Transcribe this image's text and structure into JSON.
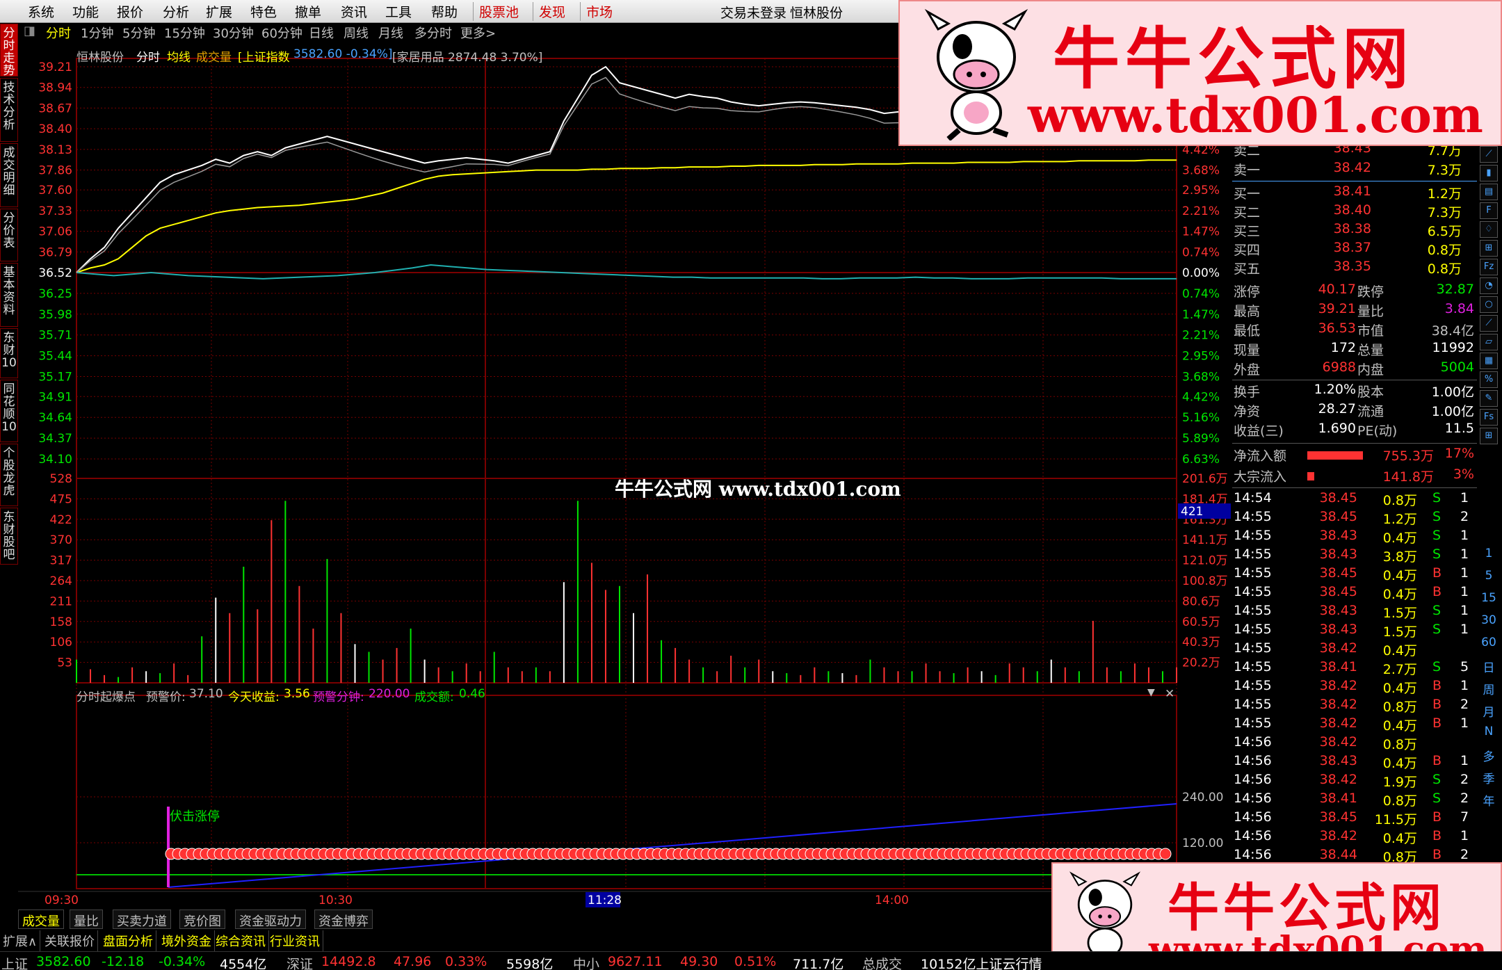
{
  "menubar": {
    "items": [
      "系统",
      "功能",
      "报价",
      "分析",
      "扩展",
      "特色",
      "撤单",
      "资讯",
      "工具",
      "帮助"
    ],
    "highlight": [
      "股票池",
      "发现",
      "市场"
    ],
    "login": "交易未登录",
    "stock_title": "恒林股份"
  },
  "sidetabs": [
    "分时走势",
    "技术分析",
    "成交明细",
    "分价表",
    "基本资料",
    "东财10",
    "同花顺10",
    "个股龙虎",
    "东财股吧"
  ],
  "periods": [
    "分时",
    "1分钟",
    "5分钟",
    "15分钟",
    "30分钟",
    "60分钟",
    "日线",
    "周线",
    "月线",
    "多分时",
    "更多>"
  ],
  "info_line": {
    "name": "恒林股份",
    "mode": "分时",
    "avg": "均线",
    "vol": "成交量",
    "index": "[上证指数",
    "index_val": "3582.60 -0.34%]",
    "sector": "[家居用品 2874.48 3.70%]"
  },
  "price_axis": {
    "left_up": [
      "39.21",
      "38.94",
      "38.67",
      "38.40",
      "38.13",
      "37.86",
      "37.60",
      "37.33",
      "37.06",
      "36.79"
    ],
    "mid": "36.52",
    "left_down": [
      "36.25",
      "35.98",
      "35.71",
      "35.44",
      "35.17",
      "34.91",
      "34.64",
      "34.37",
      "34.10"
    ],
    "right_up": [
      "4.42%",
      "3.68%",
      "2.95%",
      "2.21%",
      "1.47%",
      "0.74%"
    ],
    "right_mid": "0.00%",
    "right_down": [
      "0.74%",
      "1.47%",
      "2.21%",
      "2.95%",
      "3.68%",
      "4.42%",
      "5.16%",
      "5.89%",
      "6.63%"
    ]
  },
  "vol_axis": {
    "left": [
      "528",
      "475",
      "422",
      "370",
      "317",
      "264",
      "211",
      "158",
      "106",
      "53"
    ],
    "right": [
      "201.6万",
      "181.4万",
      "161.3万",
      "141.1万",
      "121.0万",
      "100.8万",
      "80.6万",
      "60.5万",
      "40.3万",
      "20.2万"
    ],
    "cursor": "421"
  },
  "indicator": {
    "name": "分时起爆点",
    "warn_label": "预警价:",
    "warn_val": "37.10",
    "income_label": "今天收益:",
    "income_val": "3.56",
    "warnmin_label": "预警分钟:",
    "warnmin_val": "220.00",
    "amount_label": "成交额:",
    "amount_val": "0.46",
    "signal": "伏击涨停",
    "axis": [
      "240.00",
      "120.00"
    ]
  },
  "time_axis": {
    "labels": [
      "09:30",
      "10:30",
      "11:28",
      "14:00"
    ],
    "cursor": "11:28"
  },
  "orderbook": {
    "sells": [
      {
        "label": "卖二",
        "price": "38.43",
        "vol": "7.7万"
      },
      {
        "label": "卖一",
        "price": "38.42",
        "vol": "7.3万"
      }
    ],
    "buys": [
      {
        "label": "买一",
        "price": "38.41",
        "vol": "1.2万"
      },
      {
        "label": "买二",
        "price": "38.40",
        "vol": "7.3万"
      },
      {
        "label": "买三",
        "price": "38.38",
        "vol": "6.5万"
      },
      {
        "label": "买四",
        "price": "38.37",
        "vol": "0.8万"
      },
      {
        "label": "买五",
        "price": "38.35",
        "vol": "0.8万"
      }
    ]
  },
  "stats": [
    [
      "涨停",
      "40.17",
      "跌停",
      "32.87"
    ],
    [
      "最高",
      "39.21",
      "量比",
      "3.84"
    ],
    [
      "最低",
      "36.53",
      "市值",
      "38.4亿"
    ],
    [
      "现量",
      "172",
      "总量",
      "11992"
    ],
    [
      "外盘",
      "6988",
      "内盘",
      "5004"
    ],
    [
      "换手",
      "1.20%",
      "股本",
      "1.00亿"
    ],
    [
      "净资",
      "28.27",
      "流通",
      "1.00亿"
    ],
    [
      "收益(三)",
      "1.690",
      "PE(动)",
      "11.5"
    ]
  ],
  "flows": [
    {
      "label": "净流入额",
      "val": "755.3万",
      "pct": "17%",
      "fill": 1
    },
    {
      "label": "大宗流入",
      "val": "141.8万",
      "pct": "3%",
      "fill": 0.12
    }
  ],
  "ticks": [
    [
      "14:54",
      "38.45",
      "0.8万",
      "S",
      "1"
    ],
    [
      "14:55",
      "38.45",
      "1.2万",
      "S",
      "2"
    ],
    [
      "14:55",
      "38.43",
      "0.4万",
      "S",
      "1"
    ],
    [
      "14:55",
      "38.43",
      "3.8万",
      "S",
      "1"
    ],
    [
      "14:55",
      "38.45",
      "0.4万",
      "B",
      "1"
    ],
    [
      "14:55",
      "38.45",
      "0.4万",
      "B",
      "1"
    ],
    [
      "14:55",
      "38.43",
      "1.5万",
      "S",
      "1"
    ],
    [
      "14:55",
      "38.43",
      "1.5万",
      "S",
      "1"
    ],
    [
      "14:55",
      "38.42",
      "0.4万",
      "",
      ""
    ],
    [
      "14:55",
      "38.41",
      "2.7万",
      "S",
      "5"
    ],
    [
      "14:55",
      "38.42",
      "0.4万",
      "B",
      "1"
    ],
    [
      "14:55",
      "38.42",
      "0.8万",
      "B",
      "2"
    ],
    [
      "14:55",
      "38.42",
      "0.4万",
      "B",
      "1"
    ],
    [
      "14:56",
      "38.42",
      "0.8万",
      "",
      ""
    ],
    [
      "14:56",
      "38.43",
      "0.4万",
      "B",
      "1"
    ],
    [
      "14:56",
      "38.42",
      "1.9万",
      "S",
      "2"
    ],
    [
      "14:56",
      "38.41",
      "0.8万",
      "S",
      "2"
    ],
    [
      "14:56",
      "38.45",
      "11.5万",
      "B",
      "7"
    ],
    [
      "14:56",
      "38.42",
      "0.4万",
      "B",
      "1"
    ],
    [
      "14:56",
      "38.44",
      "0.8万",
      "B",
      "2"
    ]
  ],
  "right_icons": [
    "1",
    "5",
    "15",
    "30",
    "60",
    "日",
    "周",
    "月",
    "N",
    "多",
    "季",
    "年"
  ],
  "subtabs": [
    "成交量",
    "量比",
    "买卖力道",
    "竞价图",
    "资金驱动力",
    "资金博弈"
  ],
  "bottomtabs": [
    "扩展∧",
    "关联报价",
    "盘面分析",
    "境外资金",
    "综合资讯",
    "行业资讯"
  ],
  "statusbar": {
    "sh": "上证",
    "sh_val": "3582.60",
    "sh_chg": "-12.18",
    "sh_pct": "-0.34%",
    "sh_amt": "4554亿",
    "sz": "深证",
    "sz_val": "14492.8",
    "sz_chg": "47.96",
    "sz_pct": "0.33%",
    "sz_amt": "5598亿",
    "zx": "中小",
    "zx_val": "9627.11",
    "zx_chg": "49.30",
    "zx_pct": "0.51%",
    "zx_amt": "711.7亿",
    "total": "总成交",
    "total_val": "10152亿上证云行情"
  },
  "watermark": {
    "title": "牛牛公式网",
    "url": "www.tdx001.com",
    "center": "牛牛公式网 www.tdx001.com"
  },
  "colors": {
    "up": "#ff3232",
    "down": "#00e600",
    "grid": "#7a0000",
    "price": "#ffffff",
    "avg": "#ffff00",
    "index": "#20b0b0"
  },
  "series": {
    "price": [
      36.52,
      36.7,
      36.85,
      37.1,
      37.3,
      37.5,
      37.7,
      37.8,
      37.86,
      37.92,
      38.0,
      37.95,
      38.05,
      38.1,
      38.05,
      38.15,
      38.2,
      38.25,
      38.3,
      38.25,
      38.2,
      38.15,
      38.1,
      38.05,
      38.0,
      37.95,
      37.98,
      38.0,
      38.02,
      38.0,
      37.98,
      37.95,
      38.0,
      38.05,
      38.1,
      38.5,
      38.8,
      39.1,
      39.21,
      39.0,
      38.95,
      38.9,
      38.85,
      38.8,
      38.85,
      38.82,
      38.8,
      38.75,
      38.72,
      38.7,
      38.72,
      38.74,
      38.75,
      38.74,
      38.72,
      38.7,
      38.68,
      38.65,
      38.6,
      38.62,
      38.6,
      38.58,
      38.55,
      38.52,
      38.5,
      38.48,
      38.46,
      38.47,
      38.46,
      38.45,
      38.44,
      38.44,
      38.45,
      38.44,
      38.43,
      38.44,
      38.43,
      38.42,
      38.43,
      38.44
    ],
    "avg": [
      36.52,
      36.58,
      36.62,
      36.7,
      36.85,
      37.0,
      37.1,
      37.15,
      37.2,
      37.25,
      37.3,
      37.33,
      37.35,
      37.37,
      37.38,
      37.39,
      37.4,
      37.42,
      37.44,
      37.46,
      37.48,
      37.52,
      37.56,
      37.62,
      37.68,
      37.74,
      37.78,
      37.8,
      37.81,
      37.82,
      37.83,
      37.84,
      37.85,
      37.86,
      37.86,
      37.86,
      37.86,
      37.87,
      37.87,
      37.88,
      37.88,
      37.88,
      37.89,
      37.89,
      37.9,
      37.9,
      37.9,
      37.91,
      37.91,
      37.92,
      37.92,
      37.92,
      37.92,
      37.93,
      37.93,
      37.93,
      37.94,
      37.94,
      37.94,
      37.94,
      37.95,
      37.95,
      37.95,
      37.95,
      37.96,
      37.96,
      37.96,
      37.96,
      37.97,
      37.97,
      37.97,
      37.97,
      37.98,
      37.98,
      37.98,
      37.98,
      37.98,
      37.99,
      37.99,
      37.99
    ],
    "index": [
      36.52,
      36.5,
      36.48,
      36.5,
      36.52,
      36.5,
      36.48,
      36.47,
      36.46,
      36.45,
      36.44,
      36.45,
      36.46,
      36.47,
      36.48,
      36.5,
      36.52,
      36.55,
      36.58,
      36.62,
      36.6,
      36.58,
      36.56,
      36.55,
      36.54,
      36.53,
      36.52,
      36.51,
      36.5,
      36.49,
      36.48,
      36.47,
      36.46,
      36.46,
      36.45,
      36.45,
      36.45,
      36.45,
      36.45,
      36.45,
      36.44,
      36.44,
      36.45,
      36.45,
      36.45,
      36.46,
      36.45,
      36.45,
      36.44,
      36.44,
      36.44,
      36.45,
      36.45,
      36.45,
      36.45,
      36.45,
      36.44,
      36.44,
      36.44,
      36.44
    ],
    "volume": [
      60,
      35,
      20,
      15,
      40,
      30,
      25,
      50,
      20,
      120,
      220,
      180,
      300,
      190,
      420,
      470,
      250,
      140,
      320,
      180,
      100,
      80,
      60,
      90,
      140,
      60,
      40,
      30,
      50,
      30,
      80,
      40,
      30,
      40,
      30,
      260,
      470,
      310,
      240,
      250,
      180,
      280,
      110,
      90,
      60,
      40,
      30,
      70,
      40,
      60,
      30,
      25,
      20,
      40,
      30,
      25,
      20,
      60,
      40,
      30,
      30,
      50,
      30,
      25,
      40,
      30,
      20,
      50,
      40,
      30,
      60,
      40,
      30,
      160,
      40,
      30,
      50,
      40,
      30,
      40
    ]
  }
}
